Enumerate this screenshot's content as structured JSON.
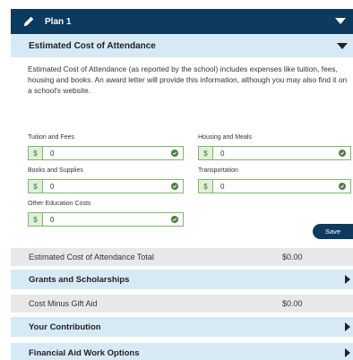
{
  "plan": {
    "title": "Plan 1"
  },
  "section": {
    "title": "Estimated Cost of Attendance"
  },
  "description": "Estimated Cost of Attendance (as reported by the school) includes expenses like tuition, fees, housing and books. An award letter will provide this information, although you may also find it on a school's website.",
  "fields": {
    "tuition": {
      "label": "Tuition and Fees",
      "currency": "$",
      "value": "0"
    },
    "housing": {
      "label": "Housing and Meals",
      "currency": "$",
      "value": "0"
    },
    "books": {
      "label": "Books and Supplies",
      "currency": "$",
      "value": "0"
    },
    "transport": {
      "label": "Transportation",
      "currency": "$",
      "value": "0"
    },
    "other": {
      "label": "Other Education Costs",
      "currency": "$",
      "value": "0"
    }
  },
  "save_label": "Save",
  "summary": {
    "total_label": "Estimated Cost of Attendance Total",
    "total_value": "$0.00",
    "grants_label": "Grants and Scholarships",
    "cost_minus_label": "Cost Minus Gift Aid",
    "cost_minus_value": "$0.00",
    "contribution_label": "Your Contribution",
    "work_label": "Financial Aid Work Options"
  },
  "colors": {
    "navy": "#0d3a5f",
    "light_blue": "#d6eaf6",
    "green": "#7cb869"
  }
}
